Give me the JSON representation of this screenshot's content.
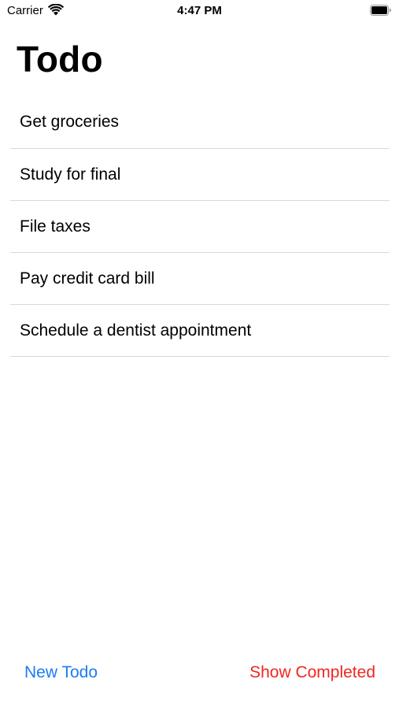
{
  "status_bar": {
    "carrier": "Carrier",
    "time": "4:47 PM",
    "wifi_icon": "wifi-icon",
    "battery_icon": "battery-full-icon"
  },
  "nav": {
    "title": "Todo"
  },
  "todos": [
    {
      "label": "Get groceries"
    },
    {
      "label": "Study for final"
    },
    {
      "label": "File taxes"
    },
    {
      "label": "Pay credit card bill"
    },
    {
      "label": "Schedule a dentist appointment"
    }
  ],
  "toolbar": {
    "new_todo_label": "New Todo",
    "show_completed_label": "Show Completed"
  },
  "colors": {
    "accent_blue": "#1a7cf5",
    "accent_red": "#f2251f",
    "separator": "#d8d8dc"
  }
}
